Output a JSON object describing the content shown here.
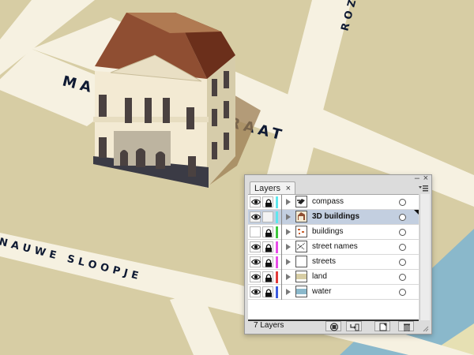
{
  "map": {
    "street_names": [
      "MAURITSSCHSTRAAT",
      "NAUWE SLOOPJE",
      "ROZE"
    ],
    "colors": {
      "ground": "#d7cda4",
      "street": "#f6f1e1",
      "water": "#8ab8cb",
      "label": "#0f1a33",
      "roof": "#8f4e32",
      "facade": "#f3ead3"
    }
  },
  "panel": {
    "tab_label": "Layers",
    "tab_close": "×",
    "minimize_glyph": "‒",
    "close_glyph": "×",
    "layer_count_label": "7 Layers",
    "layers": [
      {
        "name": "compass",
        "visible": true,
        "locked": true,
        "color": "#5ee7ee",
        "selected": false
      },
      {
        "name": "3D buildings",
        "visible": true,
        "locked": false,
        "color": "#5ee7ee",
        "selected": true
      },
      {
        "name": "buildings",
        "visible": false,
        "locked": true,
        "color": "#3ec83e",
        "selected": false
      },
      {
        "name": "street names",
        "visible": true,
        "locked": true,
        "color": "#e84de8",
        "selected": false
      },
      {
        "name": "streets",
        "visible": true,
        "locked": true,
        "color": "#e84de8",
        "selected": false
      },
      {
        "name": "land",
        "visible": true,
        "locked": true,
        "color": "#e23a3a",
        "selected": false
      },
      {
        "name": "water",
        "visible": true,
        "locked": true,
        "color": "#3b5be0",
        "selected": false
      }
    ],
    "footer_buttons": [
      "make-clipping-mask",
      "create-sublayer",
      "create-new-layer",
      "delete-layer"
    ]
  }
}
